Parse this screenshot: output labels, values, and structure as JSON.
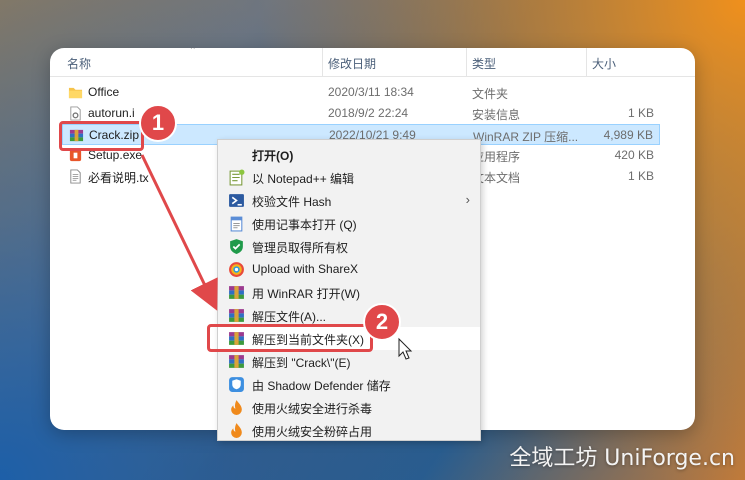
{
  "columns": {
    "name": "名称",
    "date": "修改日期",
    "type": "类型",
    "size": "大小"
  },
  "files": [
    {
      "name": "Office",
      "date": "2020/3/11 18:34",
      "type": "文件夹",
      "size": "",
      "icon": "folder-icon"
    },
    {
      "name": "autorun.i",
      "date": "2018/9/2 22:24",
      "type": "安装信息",
      "size": "1 KB",
      "icon": "settings-file-icon"
    },
    {
      "name": "Crack.zip",
      "date": "2022/10/21 9:49",
      "type": "WinRAR ZIP 压缩...",
      "size": "4,989 KB",
      "icon": "winrar-archive-icon"
    },
    {
      "name": "Setup.exe",
      "date": "",
      "type": "应用程序",
      "size": "420 KB",
      "icon": "office-setup-icon"
    },
    {
      "name": "必看说明.tx",
      "date": "",
      "type": "文本文档",
      "size": "1 KB",
      "icon": "text-file-icon"
    }
  ],
  "context_menu": [
    {
      "label": "打开(O)",
      "icon": "",
      "bold": true
    },
    {
      "label": "以 Notepad++ 编辑",
      "icon": "notepad-plus-plus-icon"
    },
    {
      "label": "校验文件 Hash",
      "icon": "powershell-icon",
      "submenu": true
    },
    {
      "label": "使用记事本打开 (Q)",
      "icon": "notepad-icon"
    },
    {
      "label": "管理员取得所有权",
      "icon": "shield-check-icon"
    },
    {
      "label": "Upload with ShareX",
      "icon": "sharex-icon"
    },
    {
      "label": "用 WinRAR 打开(W)",
      "icon": "winrar-icon"
    },
    {
      "label": "解压文件(A)...",
      "icon": "winrar-icon"
    },
    {
      "label": "解压到当前文件夹(X)",
      "icon": "winrar-icon",
      "hover": true
    },
    {
      "label": "解压到 \"Crack\\\"(E)",
      "icon": "winrar-icon"
    },
    {
      "label": "由 Shadow Defender 储存",
      "icon": "shadow-defender-icon"
    },
    {
      "label": "使用火绒安全进行杀毒",
      "icon": "huorong-icon"
    },
    {
      "label": "使用火绒安全粉碎占用",
      "icon": "huorong-icon"
    }
  ],
  "badges": {
    "step1": "1",
    "step2": "2"
  },
  "watermark": "全域工坊 UniForge.cn",
  "colors": {
    "accent_red": "#e0484a",
    "selection": "#cce8ff"
  }
}
